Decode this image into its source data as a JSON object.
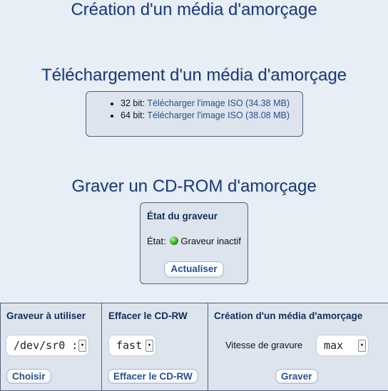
{
  "titles": {
    "main": "Création d'un média d'amorçage",
    "download": "Téléchargement d'un média d'amorçage",
    "burn": "Graver un CD-ROM d'amorçage"
  },
  "download": {
    "items": [
      {
        "prefix": "32 bit: ",
        "link": "Télécharger l'image ISO (34.38 MB)"
      },
      {
        "prefix": "64 bit: ",
        "link": "Télécharger l'image ISO (38.08 MB)"
      }
    ]
  },
  "burner_state": {
    "title": "État du graveur",
    "label": "État:",
    "status": "Graveur inactif",
    "refresh": "Actualiser"
  },
  "bottom": {
    "device": {
      "title": "Graveur à utiliser",
      "selected": "/dev/sr0 :",
      "button": "Choisir"
    },
    "erase": {
      "title": "Effacer le CD-RW",
      "selected": "fast",
      "button": "Effacer le CD-RW"
    },
    "create": {
      "title": "Création d'un média d'amorçage",
      "speed_label": "Vitesse de gravure",
      "selected": "max",
      "button": "Graver"
    }
  }
}
